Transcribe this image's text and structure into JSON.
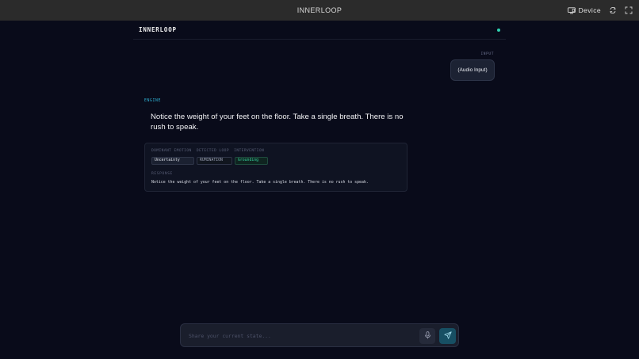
{
  "window": {
    "title": "INNERLOOP",
    "device_label": "Device",
    "icons": [
      "device-icon",
      "rotate-icon",
      "fullscreen-icon"
    ]
  },
  "app": {
    "brand": "INNERLOOP",
    "status_color": "#2fd1b0"
  },
  "input": {
    "label": "INPUT",
    "message": "(Audio Input)"
  },
  "engine": {
    "label": "ENGINE",
    "headline": "Notice the weight of your feet on the floor. Take a single breath. There is no rush to speak.",
    "analysis": {
      "headers": [
        "DOMINANT EMOTION",
        "DETECTED LOOP",
        "INTERVENTION"
      ],
      "emotion": "Uncertainty",
      "loop": "RUMINATION",
      "intervention": "Grounding"
    },
    "response_label": "RESPONSE",
    "response_text": "Notice the weight of your feet on the floor. Take a single breath. There is no rush to speak."
  },
  "composer": {
    "placeholder": "Share your current state...",
    "value": "",
    "icons": [
      "mic-icon",
      "send-icon"
    ]
  },
  "colors": {
    "background": "#090b1a",
    "accent": "#2fb3d6",
    "intervention": "#36d39f",
    "send_button": "#174f63"
  }
}
